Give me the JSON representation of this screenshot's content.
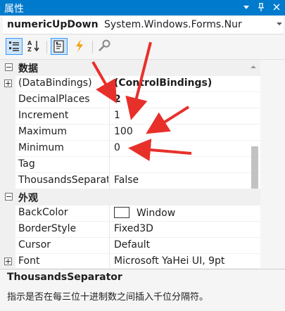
{
  "window": {
    "title": "属性",
    "icons": [
      "dropdown-arrow-icon",
      "pin-icon",
      "close-icon"
    ]
  },
  "selector": {
    "object_name": "numericUpDown",
    "object_type": "System.Windows.Forms.Nur"
  },
  "toolbar": {
    "buttons": [
      "categorized-icon",
      "alphabetical-icon",
      "properties-icon",
      "events-icon",
      "property-pages-icon"
    ]
  },
  "categories": [
    {
      "label": "数据",
      "properties": [
        {
          "name": "(DataBindings)",
          "value": "(ControlBindings)"
        },
        {
          "name": "DecimalPlaces",
          "value": "2"
        },
        {
          "name": "Increment",
          "value": "1"
        },
        {
          "name": "Maximum",
          "value": "100"
        },
        {
          "name": "Minimum",
          "value": "0"
        },
        {
          "name": "Tag",
          "value": ""
        },
        {
          "name": "ThousandsSeparator",
          "value": "False"
        }
      ]
    },
    {
      "label": "外观",
      "properties": [
        {
          "name": "BackColor",
          "value": "Window"
        },
        {
          "name": "BorderStyle",
          "value": "Fixed3D"
        },
        {
          "name": "Cursor",
          "value": "Default"
        },
        {
          "name": "Font",
          "value": "Microsoft YaHei UI, 9pt"
        }
      ]
    }
  ],
  "description": {
    "title": "ThousandsSeparator",
    "text": "指示是否在每三位十进制数之间插入千位分隔符。"
  },
  "colors": {
    "titlebar": "#007acc",
    "annotation_arrow": "#e8302a",
    "toolbar_active": "#cce4f7",
    "events_icon": "#f0a30a"
  }
}
